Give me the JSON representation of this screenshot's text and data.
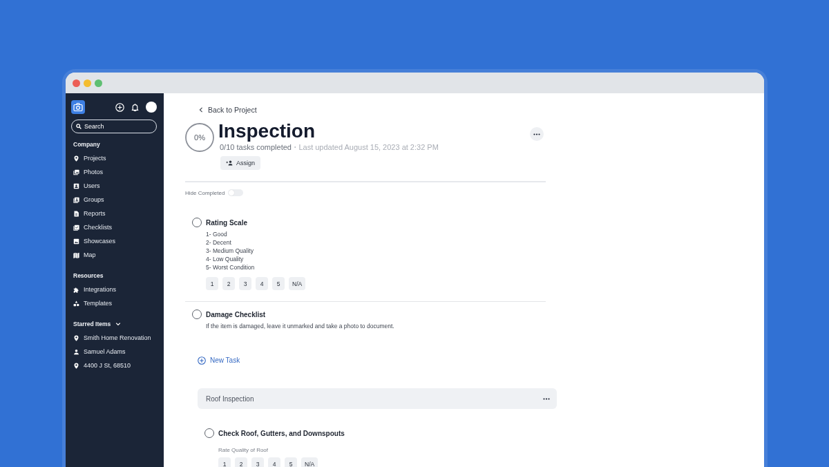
{
  "sidebar": {
    "search": {
      "placeholder": "Search"
    },
    "sections": [
      {
        "title": "Company",
        "items": [
          {
            "label": "Projects",
            "kind": "pin"
          },
          {
            "label": "Photos",
            "kind": "photos"
          },
          {
            "label": "Users",
            "kind": "contact"
          },
          {
            "label": "Groups",
            "kind": "group"
          },
          {
            "label": "Reports",
            "kind": "report"
          },
          {
            "label": "Checklists",
            "kind": "checklist"
          },
          {
            "label": "Showcases",
            "kind": "showcase"
          },
          {
            "label": "Map",
            "kind": "map"
          }
        ]
      },
      {
        "title": "Resources",
        "items": [
          {
            "label": "Integrations",
            "kind": "puzzle"
          },
          {
            "label": "Templates",
            "kind": "shapes"
          }
        ]
      }
    ],
    "starred": {
      "title": "Starred Items",
      "expanded": true,
      "items": [
        {
          "label": "Smith Home Renovation",
          "kind": "pin"
        },
        {
          "label": "Samuel Adams",
          "kind": "person"
        },
        {
          "label": "4400 J St, 68510",
          "kind": "pin"
        }
      ]
    }
  },
  "checklist": {
    "back_link": "Back to Project",
    "progress": "0%",
    "title": "Inspection",
    "tasks_completed": "0/10 tasks completed",
    "separator": "•",
    "last_updated": "Last updated August 15, 2023 at 2:32 PM",
    "assign_button": "Assign",
    "hide_completed": {
      "label": "Hide Completed",
      "on": false
    },
    "tasks": [
      {
        "title": "Rating Scale",
        "checked": false,
        "description_lines": [
          "1- Good",
          "2- Decent",
          "3- Medium Quality",
          "4- Low Quality",
          "5- Worst Condition"
        ],
        "options": [
          {
            "label": "1",
            "selected": false
          },
          {
            "label": "2",
            "selected": false
          },
          {
            "label": "3",
            "selected": false
          },
          {
            "label": "4",
            "selected": false
          },
          {
            "label": "5",
            "selected": false
          },
          {
            "label": "N/A",
            "selected": false
          }
        ]
      },
      {
        "title": "Damage Checklist",
        "checked": false,
        "description": "If the item is damaged, leave it unmarked and take a photo to document."
      }
    ],
    "new_task": "New Task",
    "sections": [
      {
        "title": "Roof Inspection",
        "tasks": [
          {
            "title": "Check Roof, Gutters, and Downspouts",
            "checked": false,
            "prompt": "Rate Quality of Roof",
            "options": [
              {
                "label": "1",
                "selected": false
              },
              {
                "label": "2",
                "selected": false
              },
              {
                "label": "3",
                "selected": false
              },
              {
                "label": "4",
                "selected": false
              },
              {
                "label": "5",
                "selected": false
              },
              {
                "label": "N/A",
                "selected": false
              }
            ]
          }
        ]
      }
    ]
  }
}
